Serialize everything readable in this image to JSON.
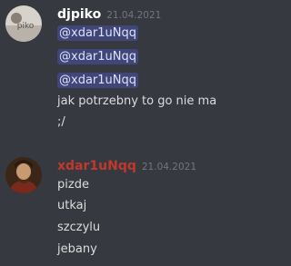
{
  "colors": {
    "background": "#36393f",
    "text": "#dcddde",
    "username_1": "#ffffff",
    "username_2": "#c0392b",
    "timestamp": "#72767d",
    "mention_bg": "#414675",
    "mention_text": "#dee0fc"
  },
  "messages": [
    {
      "username": "djpiko",
      "timestamp": "21.04.2021",
      "avatar_text": "piko",
      "avatar_icon": "avatar-photo",
      "lines": [
        {
          "mention": "@xdar1uNqq"
        },
        {
          "mention": "@xdar1uNqq"
        },
        {
          "mention": "@xdar1uNqq"
        },
        {
          "text": "jak potrzebny to go nie ma"
        },
        {
          "text": ";/"
        }
      ]
    },
    {
      "username": "xdar1uNqq",
      "timestamp": "21.04.2021",
      "avatar_icon": "portrait-painting-avatar",
      "lines": [
        {
          "text": "pizde"
        },
        {
          "text": "utkaj"
        },
        {
          "text": "szczylu"
        },
        {
          "text": "jebany"
        }
      ]
    }
  ]
}
